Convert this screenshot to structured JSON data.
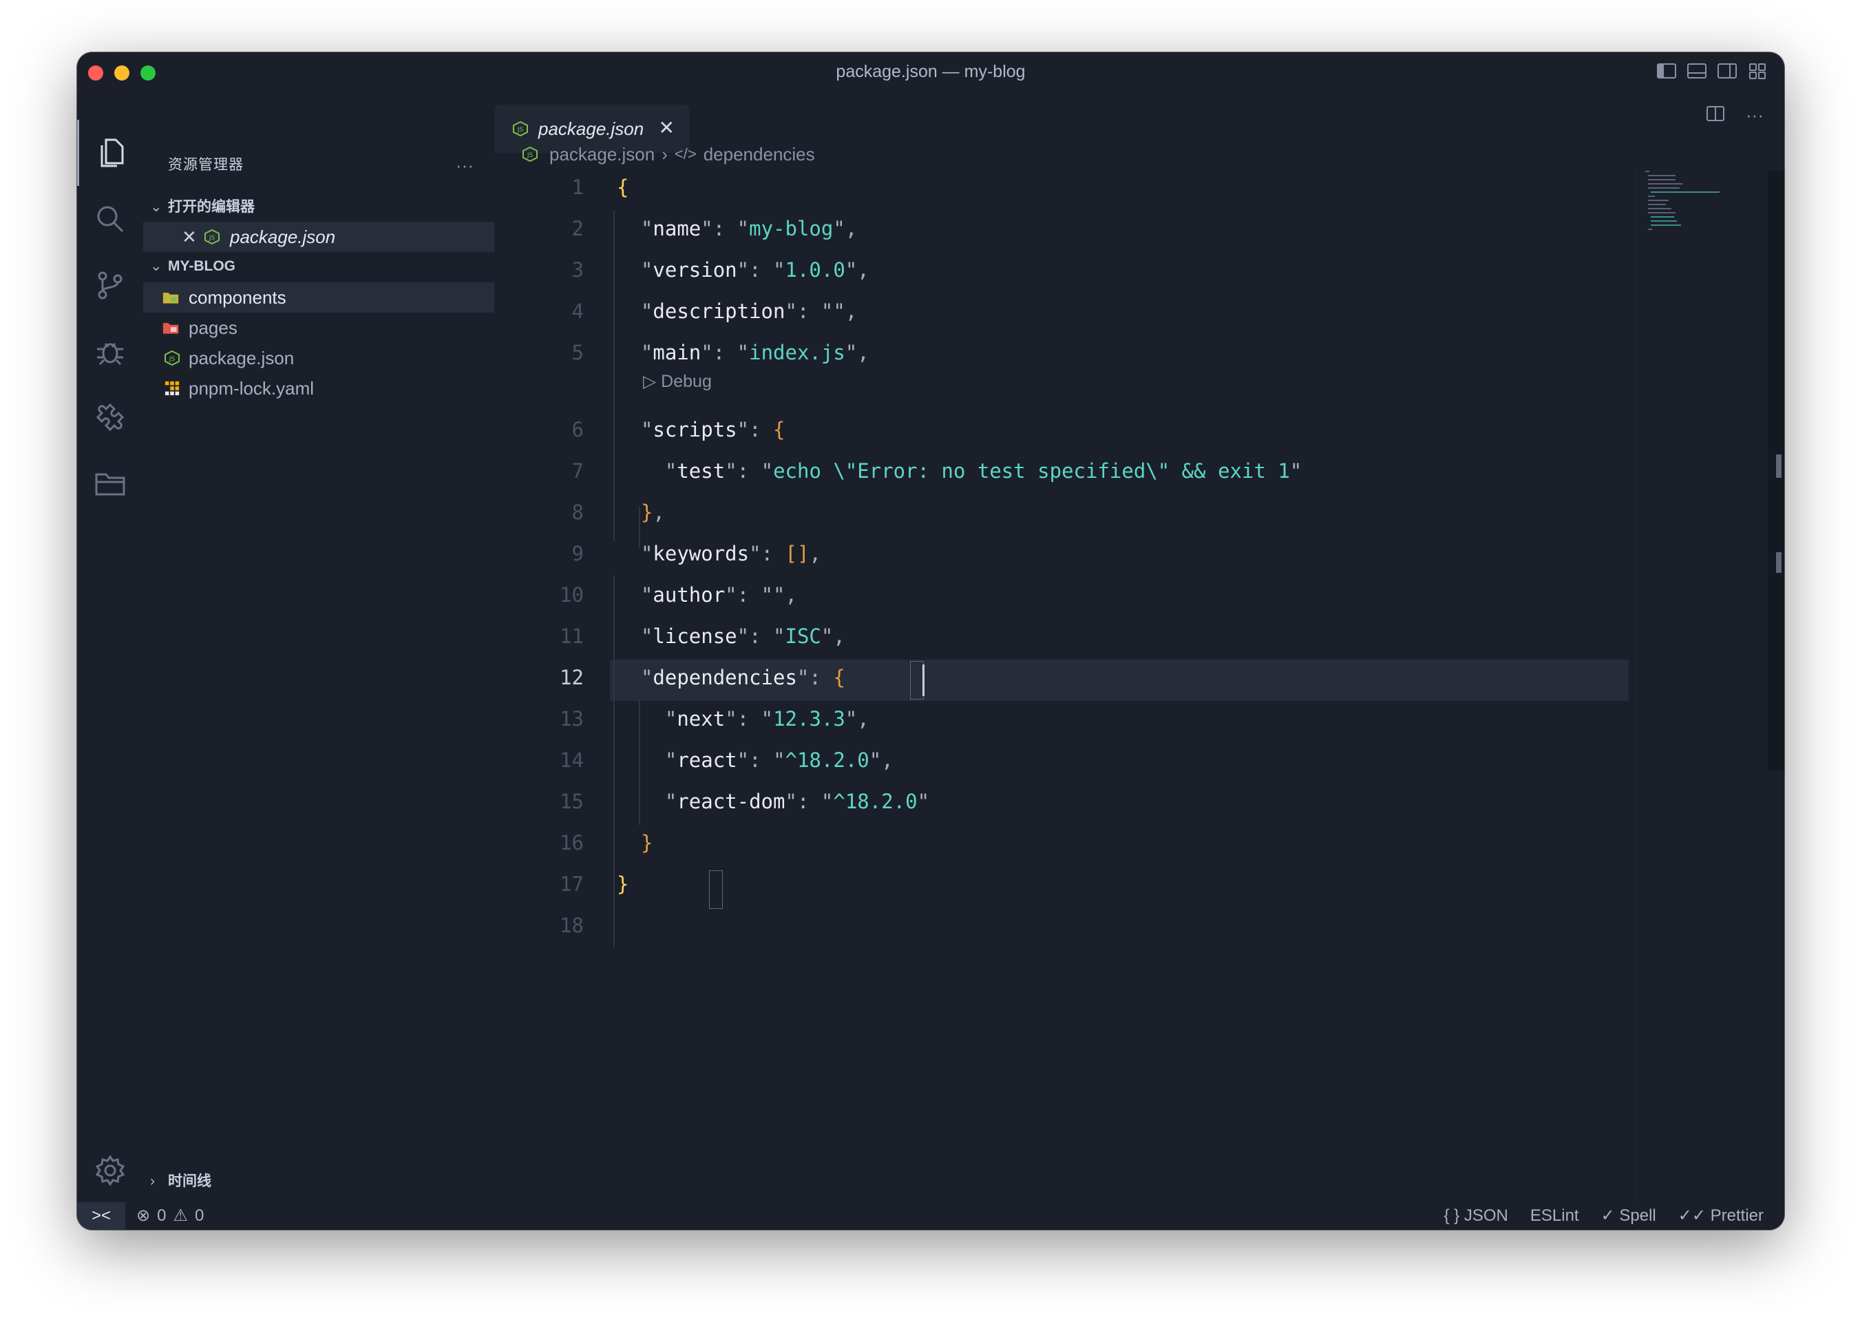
{
  "window": {
    "title": "package.json — my-blog"
  },
  "sidebar": {
    "title": "资源管理器",
    "more": "···",
    "open_editors": {
      "label": "打开的编辑器",
      "items": [
        {
          "name": "package.json"
        }
      ]
    },
    "project": {
      "label": "MY-BLOG",
      "items": [
        {
          "name": "components",
          "icon": "folder-components-icon"
        },
        {
          "name": "pages",
          "icon": "folder-pages-icon"
        },
        {
          "name": "package.json",
          "icon": "nodejs-icon"
        },
        {
          "name": "pnpm-lock.yaml",
          "icon": "pnpm-icon"
        }
      ]
    },
    "timeline": "时间线"
  },
  "tab": {
    "label": "package.json",
    "close": "✕"
  },
  "breadcrumb": {
    "file": "package.json",
    "symbol": "dependencies"
  },
  "editor": {
    "codelens": "Debug",
    "current_line": 12,
    "lines": [
      {
        "n": "1",
        "code": "{"
      },
      {
        "n": "2",
        "code": "  \"name\": \"my-blog\","
      },
      {
        "n": "3",
        "code": "  \"version\": \"1.0.0\","
      },
      {
        "n": "4",
        "code": "  \"description\": \"\","
      },
      {
        "n": "5",
        "code": "  \"main\": \"index.js\","
      },
      {
        "n": "6",
        "code": "  \"scripts\": {"
      },
      {
        "n": "7",
        "code": "    \"test\": \"echo \\\"Error: no test specified\\\" && exit 1\""
      },
      {
        "n": "8",
        "code": "  },"
      },
      {
        "n": "9",
        "code": "  \"keywords\": [],"
      },
      {
        "n": "10",
        "code": "  \"author\": \"\","
      },
      {
        "n": "11",
        "code": "  \"license\": \"ISC\","
      },
      {
        "n": "12",
        "code": "  \"dependencies\": {"
      },
      {
        "n": "13",
        "code": "    \"next\": \"12.3.3\","
      },
      {
        "n": "14",
        "code": "    \"react\": \"^18.2.0\","
      },
      {
        "n": "15",
        "code": "    \"react-dom\": \"^18.2.0\""
      },
      {
        "n": "16",
        "code": "  }"
      },
      {
        "n": "17",
        "code": "}"
      },
      {
        "n": "18",
        "code": ""
      }
    ]
  },
  "statusbar": {
    "remote": "><",
    "errors": "0",
    "warnings": "0",
    "language": "JSON",
    "language_icon": "{ }",
    "eslint": "ESLint",
    "spell": "✓ Spell",
    "prettier": "✓✓ Prettier"
  },
  "colors": {
    "background": "#1b1f2a",
    "string": "#5bd7c4",
    "bracket_level1": "#ffd25c",
    "bracket_level2": "#e59b48",
    "bracket_level3": "#4fb3ff"
  }
}
